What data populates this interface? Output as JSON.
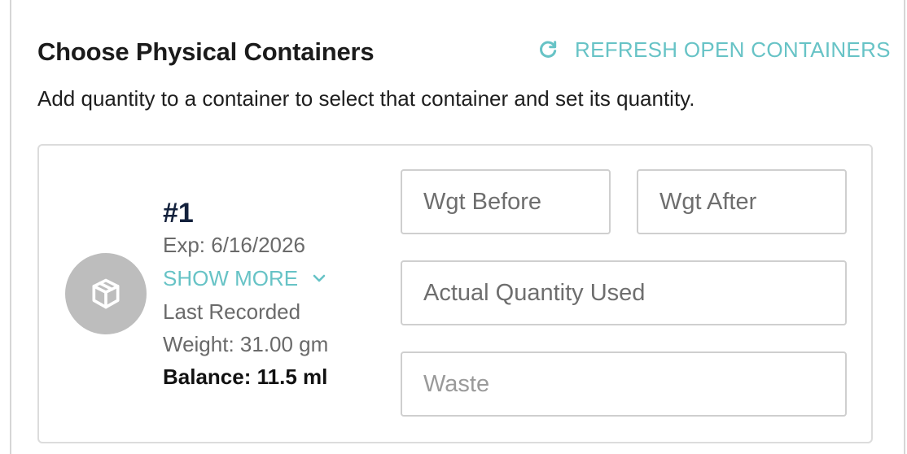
{
  "header": {
    "title": "Choose Physical Containers",
    "refresh_label": "REFRESH OPEN CONTAINERS",
    "subtitle": "Add quantity to a container to select that container and set its quantity."
  },
  "container": {
    "number": "#1",
    "expiry": "Exp: 6/16/2026",
    "show_more_label": "SHOW MORE",
    "last_recorded": "Last Recorded Weight: 31.00 gm",
    "balance": "Balance: 11.5 ml",
    "icon": "package-icon"
  },
  "fields": {
    "wgt_before_placeholder": "Wgt Before",
    "wgt_after_placeholder": "Wgt After",
    "actual_qty_placeholder": "Actual Quantity Used",
    "waste_placeholder": "Waste"
  },
  "colors": {
    "accent": "#67c3c6",
    "avatar_bg": "#bdbdbd",
    "container_number": "#13213c"
  }
}
